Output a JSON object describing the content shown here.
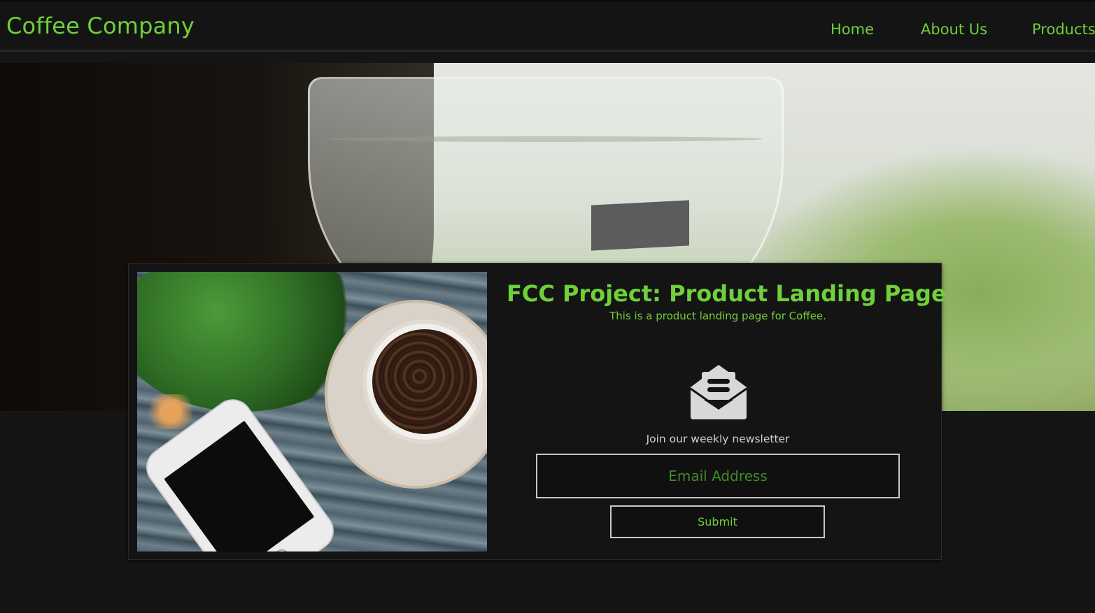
{
  "header": {
    "brand": "Coffee Company",
    "nav": [
      {
        "label": "Home"
      },
      {
        "label": "About Us"
      },
      {
        "label": "Products"
      }
    ]
  },
  "main": {
    "title": "FCC Project: Product Landing Page",
    "subtitle": "This is a product landing page for Coffee.",
    "newsletter": {
      "icon": "envelope-open-icon",
      "label": "Join our weekly newsletter",
      "email_placeholder": "Email Address",
      "email_value": "",
      "submit_label": "Submit"
    }
  },
  "colors": {
    "accent": "#6fd03a",
    "background": "#151515",
    "card": "#141414",
    "border": "#c8c8c8"
  }
}
